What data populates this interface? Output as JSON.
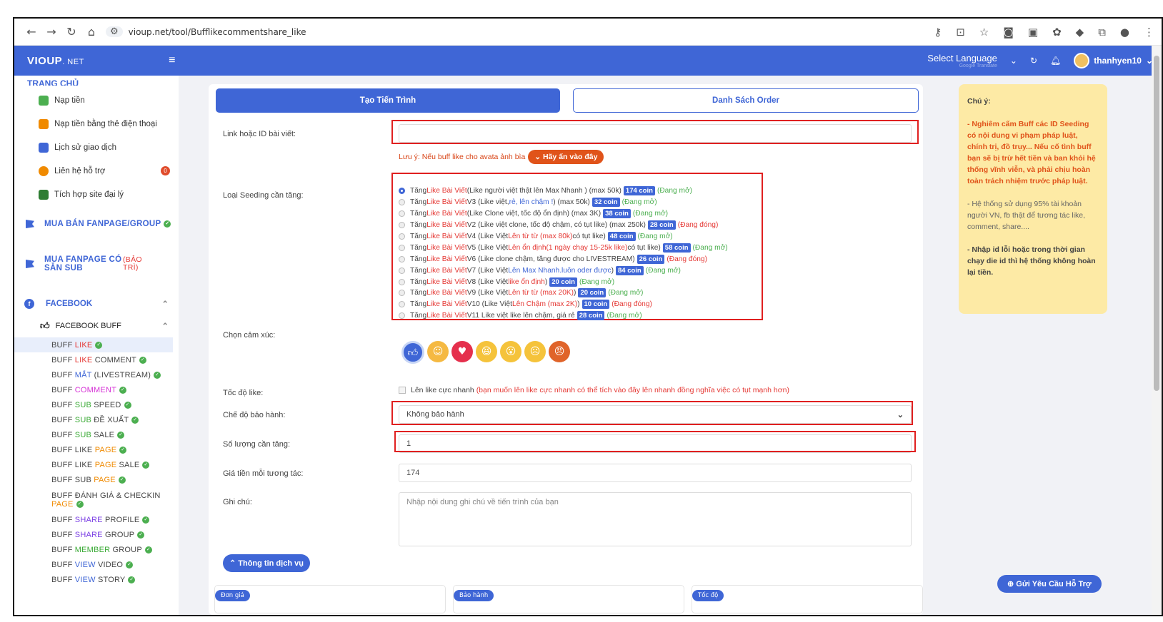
{
  "browser": {
    "url": "vioup.net/tool/Bufflikecommentshare_like"
  },
  "topbar": {
    "brand": "VIOUP",
    "brand_suffix": ". NET",
    "menu_icon": "hamburger-icon",
    "language": "Select Language",
    "translate_note": "Google Translate",
    "username": "thanhyen10"
  },
  "sidebar": {
    "home": "TRANG CHỦ",
    "items": [
      {
        "label": "Nạp tiền",
        "color": "#4caf50"
      },
      {
        "label": "Nạp tiền bằng thẻ điện thoại",
        "color": "#f08a00"
      },
      {
        "label": "Lịch sử giao dịch",
        "color": "#3f66d6"
      },
      {
        "label": "Liên hệ hỗ trợ",
        "color": "#f08a00",
        "badge": "0"
      },
      {
        "label": "Tích hợp site đại lý",
        "color": "#2e7d32"
      }
    ],
    "sections": {
      "fanpage_group": "MUA BÁN FANPAGE/GROUP",
      "fanpage_sub": "MUA FANPAGE CÓ SẴN SUB",
      "maintenance": "(BẢO TRÌ)",
      "facebook": "FACEBOOK",
      "facebook_buff": "FACEBOOK BUFF"
    },
    "buff_items": [
      {
        "p1": "BUFF ",
        "h": "LIKE",
        "p2": "",
        "cls": "red"
      },
      {
        "p1": "BUFF ",
        "h": "LIKE",
        "p2": " COMMENT",
        "cls": "red"
      },
      {
        "p1": "BUFF ",
        "h": "MẮT",
        "p2": " (LIVESTREAM)",
        "cls": "blue"
      },
      {
        "p1": "BUFF ",
        "h": "COMMENT",
        "p2": "",
        "cls": "mag"
      },
      {
        "p1": "BUFF ",
        "h": "SUB",
        "p2": " SPEED",
        "cls": "green"
      },
      {
        "p1": "BUFF ",
        "h": "SUB",
        "p2": " ĐỀ XUẤT",
        "cls": "green"
      },
      {
        "p1": "BUFF ",
        "h": "SUB",
        "p2": " SALE",
        "cls": "green"
      },
      {
        "p1": "BUFF LIKE ",
        "h": "PAGE",
        "p2": "",
        "cls": "orange"
      },
      {
        "p1": "BUFF LIKE ",
        "h": "PAGE",
        "p2": " SALE",
        "cls": "orange"
      },
      {
        "p1": "BUFF SUB ",
        "h": "PAGE",
        "p2": "",
        "cls": "orange"
      },
      {
        "p1": "BUFF ĐÁNH GIÁ & CHECKIN ",
        "h": "PAGE",
        "p2": "",
        "cls": "orange"
      },
      {
        "p1": "BUFF ",
        "h": "SHARE",
        "p2": " PROFILE",
        "cls": "purple"
      },
      {
        "p1": "BUFF ",
        "h": "SHARE",
        "p2": " GROUP",
        "cls": "purple"
      },
      {
        "p1": "BUFF ",
        "h": "MEMBER",
        "p2": " GROUP",
        "cls": "green"
      },
      {
        "p1": "BUFF ",
        "h": "VIEW",
        "p2": " VIDEO",
        "cls": "blue"
      },
      {
        "p1": "BUFF ",
        "h": "VIEW",
        "p2": " STORY",
        "cls": "blue"
      }
    ]
  },
  "tabs": {
    "create": "Tạo Tiến Trình",
    "orders": "Danh Sách Order"
  },
  "form": {
    "link_label": "Link hoặc ID bài viết:",
    "link_value": "",
    "note_text": "Lưu ý: Nếu buff like cho avata ảnh bìa",
    "note_button": "⌄ Hãy ấn vào đây",
    "seeding_label": "Loại Seeding cần tăng:",
    "options": [
      {
        "a": "Tăng ",
        "b": "Like Bài Viết",
        "c": " (Like người việt thật lên Max Nhanh ) (max 50k)",
        "coin": "174 coin",
        "status": "(Đang mở)",
        "open": true,
        "selected": true
      },
      {
        "a": "Tăng ",
        "b": "Like Bài Viết",
        "c": " V3 (Like việt, ",
        "c2": "rẻ, lên chậm !",
        "c3": ") (max 50k)",
        "coin": "32 coin",
        "status": "(Đang mở)",
        "open": true
      },
      {
        "a": "Tăng ",
        "b": "Like Bài Viết",
        "c": " (Like Clone việt, tốc độ ổn định) (max 3K)",
        "coin": "38 coin",
        "status": "(Đang mở)",
        "open": true
      },
      {
        "a": "Tăng ",
        "b": "Like Bài Viết",
        "c": " V2 (Like việt clone, tốc độ chậm, có tụt like) (max 250k)",
        "coin": "28 coin",
        "status": "(Đang đóng)",
        "open": false
      },
      {
        "a": "Tăng ",
        "b": "Like Bài Viết",
        "c": " V4 (Like Việt ",
        "c2": "Lên từ từ (max 80k)",
        "c3": " có tụt like)",
        "coin": "48 coin",
        "status": "(Đang mở)",
        "open": true
      },
      {
        "a": "Tăng ",
        "b": "Like Bài Viết",
        "c": " V5 (Like Việt ",
        "c2": "Lên ổn định(1 ngày chạy 15-25k like)",
        "c3": " có tụt like)",
        "coin": "58 coin",
        "status": "(Đang mở)",
        "open": true
      },
      {
        "a": "Tăng ",
        "b": "Like Bài Viết",
        "c": " V6 (Like clone chậm, tăng được cho LIVESTREAM)",
        "coin": "26 coin",
        "status": "(Đang đóng)",
        "open": false
      },
      {
        "a": "Tăng ",
        "b": "Like Bài Viết",
        "c": " V7 (Like Việt ",
        "c2": "Lên Max Nhanh.luôn oder được",
        "c3": ")",
        "coin": "84 coin",
        "status": "(Đang mở)",
        "open": true
      },
      {
        "a": "Tăng ",
        "b": "Like Bài Viết",
        "c": " V8 (Like Việt ",
        "c2": "like ổn định",
        "c3": ")",
        "coin": "20 coin",
        "status": "(Đang mở)",
        "open": true
      },
      {
        "a": "Tăng ",
        "b": "Like Bài Viết",
        "c": " V9 (Like Việt ",
        "c2": "Lên từ từ (max 20K)",
        "c3": " )",
        "coin": "20 coin",
        "status": "(Đang mở)",
        "open": true
      },
      {
        "a": "Tăng ",
        "b": "Like Bài Viết",
        "c": " V10 (Like Việt ",
        "c2": "Lên Chậm (max 2K)",
        "c3": " )",
        "coin": "10 coin",
        "status": "(Đang đóng)",
        "open": false
      },
      {
        "a": "Tăng ",
        "b": "Like Bài Viết",
        "c": " V11 Like việt like lên chậm, giá rẻ",
        "coin": "28 coin",
        "status": "(Đang mở)",
        "open": true
      }
    ],
    "emotion_label": "Chọn cảm xúc:",
    "emotions": [
      "like-icon",
      "care-icon",
      "love-icon",
      "haha-icon",
      "wow-icon",
      "sad-icon",
      "angry-icon"
    ],
    "speed_label": "Tốc độ like:",
    "speed_text": "Lên like cực nhanh",
    "speed_note": "(bạn muốn lên like cực nhanh có thể tích vào đây lên nhanh đồng nghĩa việc có tụt mạnh hơn)",
    "warranty_label": "Chế độ bảo hành:",
    "warranty_value": "Không bảo hành",
    "qty_label": "Số lượng cần tăng:",
    "qty_value": "1",
    "price_label": "Giá tiền mỗi tương tác:",
    "price_value": "174",
    "note_label": "Ghi chú:",
    "note_placeholder": "Nhập nội dung ghi chú về tiến trình của bạn",
    "service_button": "⌃ Thông tin dịch vụ",
    "mini_cards": [
      "Đơn giá",
      "Bảo hành",
      "Tốc độ"
    ]
  },
  "notice": {
    "title": "Chú ý:",
    "warn1": "- Nghiêm cấm Buff các ID Seeding có nội dung vi phạm pháp luật, chính trị, đồ trụy... Nếu cố tình buff bạn sẽ bị trừ hết tiền và ban khỏi hệ thống vĩnh viễn, và phải chịu hoàn toàn trách nhiệm trước pháp luật.",
    "warn2": "- Hệ thống sử dụng 95% tài khoản người VN, fb thật để tương tác like, comment, share....",
    "warn3": "- Nhập id lỗi hoặc trong thời gian chạy die id thì hệ thống không hoàn lại tiền."
  },
  "support_button": "⊕ Gửi Yêu Cầu Hỗ Trợ"
}
